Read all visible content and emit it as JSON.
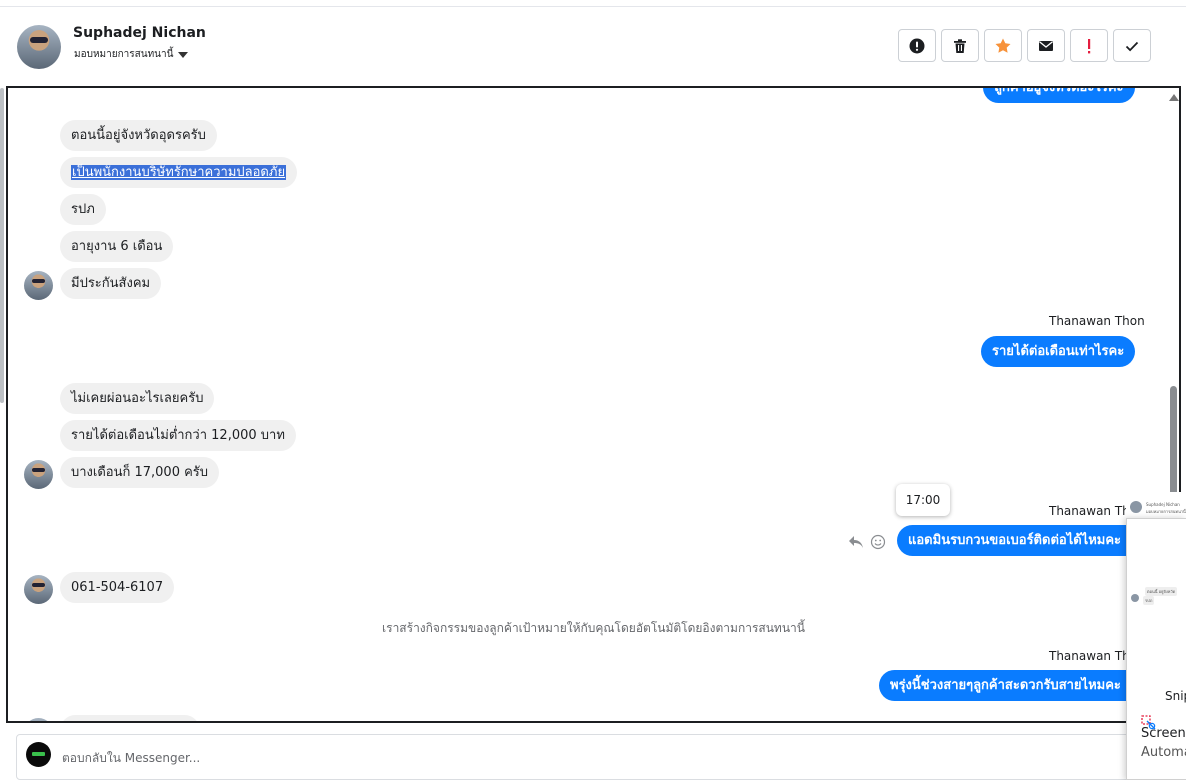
{
  "header": {
    "contact_name": "Suphadej Nichan",
    "assign_label": "มอบหมายการสนทนานี้"
  },
  "actions": [
    {
      "icon": "alert-circle-icon",
      "color": "#1c1e21"
    },
    {
      "icon": "trash-icon",
      "color": "#1c1e21"
    },
    {
      "icon": "star-icon",
      "color": "#f7923a"
    },
    {
      "icon": "envelope-icon",
      "color": "#1c1e21"
    },
    {
      "icon": "exclamation-icon",
      "color": "#e41e3f"
    },
    {
      "icon": "check-icon",
      "color": "#1c1e21"
    }
  ],
  "messages": {
    "top_out_clipped": "ลูกค้าอยู่จังหวัดอะไรคะ",
    "in1": "ตอนนี้อยู่จังหวัดอุดรครับ",
    "in2": "เป็นพนักงานบริษัทรักษาความปลอดภัย",
    "in3": "รปภ",
    "in4": "อายุงาน 6 เดือน",
    "in5": "มีประกันสังคม",
    "sender1": "Thanawan Thon",
    "out1": "รายได้ต่อเดือนเท่าไรคะ",
    "in6": "ไม่เคยผ่อนอะไรเลยครับ",
    "in7": "รายได้ต่อเดือนไม่ต่ำกว่า 12,000 บาท",
    "in8": "บางเดือนก็ 17,000 ครับ",
    "tooltip_time": "17:00",
    "sender2": "Thanawan Thon",
    "out2": "แอดมินรบกวนขอเบอร์ติดต่อได้ไหมคะ",
    "in9": "061-504-6107",
    "system": "เราสร้างกิจกรรมของลูกค้าเป้าหมายให้กับคุณโดยอัตโนมัติโดยอิงตามการสนทนานี้",
    "sender3": "Thanawan Thon",
    "out3": "พรุ่งนี้ช่วงสายๆลูกค้าสะดวกรับสายไหมคะ"
  },
  "reply": {
    "placeholder": "ตอบกลับใน Messenger..."
  },
  "snip": {
    "tiny_name": "Suphadej Nichan",
    "tiny_sub": "มอบหมายการสนทนานี้",
    "tiny_msg1": "ตอนนี้ อยู่จังหวัด",
    "tiny_msg2": "รปภ",
    "title": "Snip",
    "heading": "Screens",
    "subheading": "Automa"
  }
}
